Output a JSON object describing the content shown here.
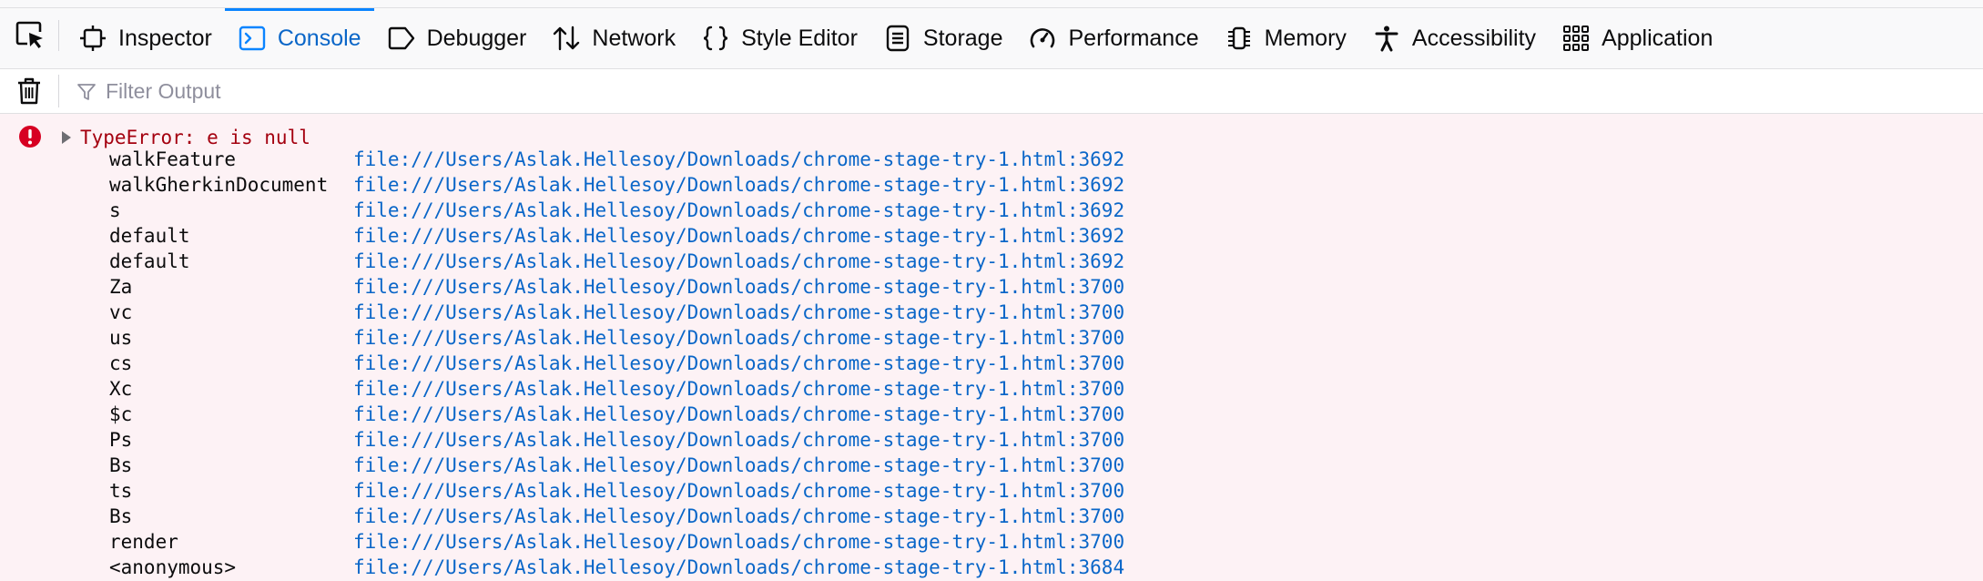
{
  "toolbar": {
    "tabs": [
      {
        "label": "Inspector",
        "icon": "inspector-icon"
      },
      {
        "label": "Console",
        "icon": "console-icon",
        "selected": true
      },
      {
        "label": "Debugger",
        "icon": "debugger-icon"
      },
      {
        "label": "Network",
        "icon": "network-icon"
      },
      {
        "label": "Style Editor",
        "icon": "style-editor-icon"
      },
      {
        "label": "Storage",
        "icon": "storage-icon"
      },
      {
        "label": "Performance",
        "icon": "performance-icon"
      },
      {
        "label": "Memory",
        "icon": "memory-icon"
      },
      {
        "label": "Accessibility",
        "icon": "accessibility-icon"
      },
      {
        "label": "Application",
        "icon": "application-icon"
      }
    ]
  },
  "filter": {
    "placeholder": "Filter Output",
    "value": ""
  },
  "message": {
    "text": "TypeError: e is null",
    "frames": [
      {
        "fn": "walkFeature",
        "location": "file:///Users/Aslak.Hellesoy/Downloads/chrome-stage-try-1.html:3692"
      },
      {
        "fn": "walkGherkinDocument",
        "location": "file:///Users/Aslak.Hellesoy/Downloads/chrome-stage-try-1.html:3692"
      },
      {
        "fn": "s",
        "location": "file:///Users/Aslak.Hellesoy/Downloads/chrome-stage-try-1.html:3692"
      },
      {
        "fn": "default",
        "location": "file:///Users/Aslak.Hellesoy/Downloads/chrome-stage-try-1.html:3692"
      },
      {
        "fn": "default",
        "location": "file:///Users/Aslak.Hellesoy/Downloads/chrome-stage-try-1.html:3692"
      },
      {
        "fn": "Za",
        "location": "file:///Users/Aslak.Hellesoy/Downloads/chrome-stage-try-1.html:3700"
      },
      {
        "fn": "vc",
        "location": "file:///Users/Aslak.Hellesoy/Downloads/chrome-stage-try-1.html:3700"
      },
      {
        "fn": "us",
        "location": "file:///Users/Aslak.Hellesoy/Downloads/chrome-stage-try-1.html:3700"
      },
      {
        "fn": "cs",
        "location": "file:///Users/Aslak.Hellesoy/Downloads/chrome-stage-try-1.html:3700"
      },
      {
        "fn": "Xc",
        "location": "file:///Users/Aslak.Hellesoy/Downloads/chrome-stage-try-1.html:3700"
      },
      {
        "fn": "$c",
        "location": "file:///Users/Aslak.Hellesoy/Downloads/chrome-stage-try-1.html:3700"
      },
      {
        "fn": "Ps",
        "location": "file:///Users/Aslak.Hellesoy/Downloads/chrome-stage-try-1.html:3700"
      },
      {
        "fn": "Bs",
        "location": "file:///Users/Aslak.Hellesoy/Downloads/chrome-stage-try-1.html:3700"
      },
      {
        "fn": "ts",
        "location": "file:///Users/Aslak.Hellesoy/Downloads/chrome-stage-try-1.html:3700"
      },
      {
        "fn": "Bs",
        "location": "file:///Users/Aslak.Hellesoy/Downloads/chrome-stage-try-1.html:3700"
      },
      {
        "fn": "render",
        "location": "file:///Users/Aslak.Hellesoy/Downloads/chrome-stage-try-1.html:3700"
      },
      {
        "fn": "<anonymous>",
        "location": "file:///Users/Aslak.Hellesoy/Downloads/chrome-stage-try-1.html:3684"
      }
    ]
  },
  "colors": {
    "accent": "#0a84ff",
    "selected_text": "#0a66c8",
    "error_text": "#a4000f",
    "error_background": "#fdf2f5",
    "link": "#0a66c8"
  }
}
